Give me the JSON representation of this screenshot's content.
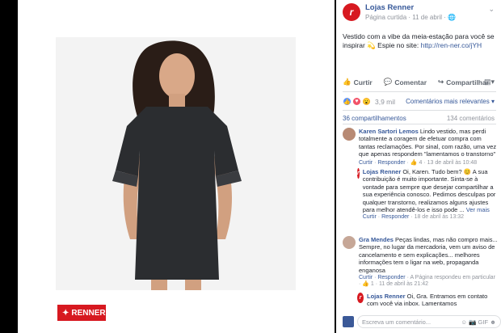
{
  "photo": {
    "brand_badge": "RENNER"
  },
  "post": {
    "page_name": "Lojas Renner",
    "meta_prefix": "Página curtida",
    "date": "11 de abril",
    "text": "Vestido com a vibe da meia-estação para você se inspirar 💫 Espie no site:",
    "link": "http://ren-ner.co/jYH",
    "actions": {
      "like": "Curtir",
      "comment": "Comentar",
      "share": "Compartilhar"
    },
    "reactions_count": "3,9 mil",
    "relevance": "Comentários mais relevantes ▾",
    "shares": "36 compartilhamentos",
    "comment_count": "134 comentários"
  },
  "comments": [
    {
      "name": "Karen Sartori Lemos",
      "text": "Lindo vestido, mas perdi totalmente a coragem de efetuar compra com tantas reclamações. Por sinal, com razão, uma vez que apenas respondem \"lamentamos o transtorno\"",
      "like": "Curtir",
      "reply": "Responder",
      "meta": "👍 4 · 13 de abril às 10:48"
    },
    {
      "name": "Lojas Renner",
      "text": "Oi, Karen. Tudo bem? 😊 A sua contribuição é muito importante. Sinta-se à vontade para sempre que desejar compartilhar a sua experiência conosco. Pedimos desculpas por qualquer transtorno, realizamos alguns ajustes para melhor atendê-los e isso pode ...",
      "more": "Ver mais",
      "like": "Curtir",
      "reply": "Responder",
      "meta": "18 de abril às 13:32"
    },
    {
      "name": "Gra Mendes",
      "text": "Peças lindas, mas não compro mais... Sempre, no lugar da mercadoria, vem um aviso de cancelamento e sem explicações... melhores informações tem o ligar na web, propaganda enganosa",
      "like": "Curtir",
      "reply": "Responder",
      "meta": "· A Página respondeu em particular · 👍 1 · 11 de abril às 21:42"
    },
    {
      "name": "Lojas Renner",
      "text": "Oi, Gra. Entramos em contato com você via inbox. Lamentamos"
    }
  ],
  "writer": {
    "placeholder": "Escreva um comentário..."
  },
  "colors": {
    "brand": "#d71920",
    "link": "#365899"
  }
}
